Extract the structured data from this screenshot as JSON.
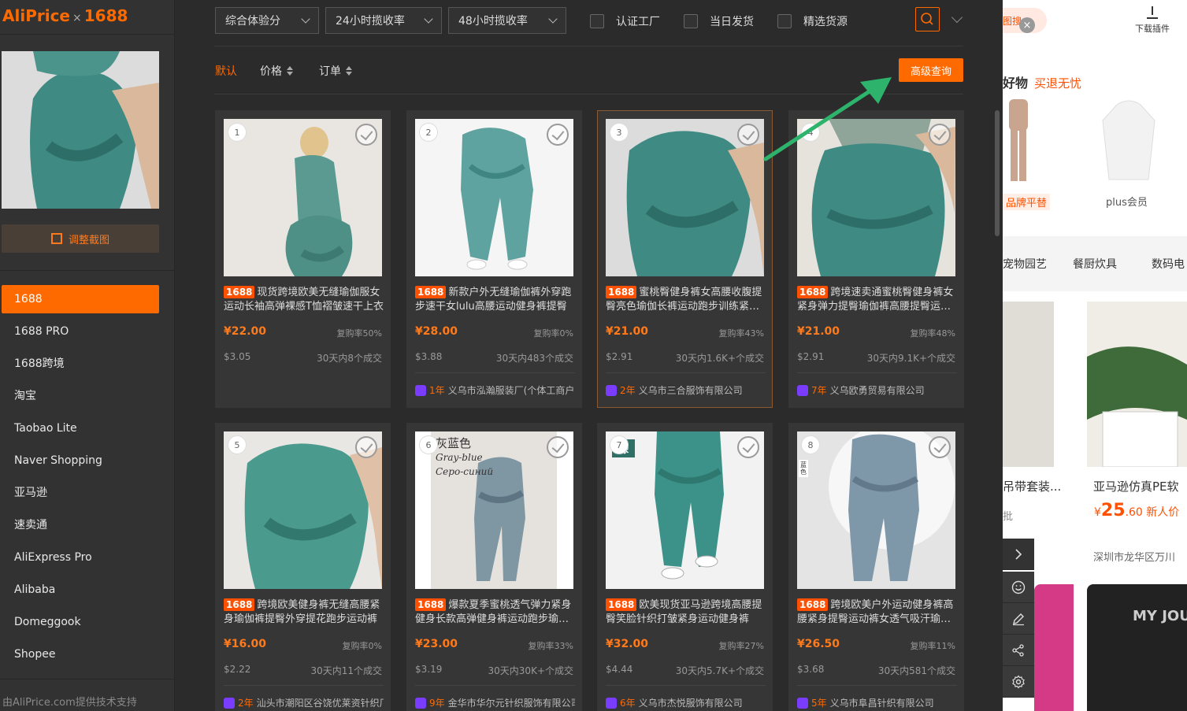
{
  "logo": {
    "brand": "AliPrice",
    "times": "×",
    "platform": "1688"
  },
  "crop_button": "调整截图",
  "platforms": [
    {
      "label": "1688",
      "active": true
    },
    {
      "label": "1688 PRO"
    },
    {
      "label": "1688跨境"
    },
    {
      "label": "淘宝"
    },
    {
      "label": "Taobao Lite"
    },
    {
      "label": "Naver Shopping"
    },
    {
      "label": "亚马逊"
    },
    {
      "label": "速卖通"
    },
    {
      "label": "AliExpress Pro"
    },
    {
      "label": "Alibaba"
    },
    {
      "label": "Domeggook"
    },
    {
      "label": "Shopee"
    }
  ],
  "powered_by": "由AliPrice.com提供技术支持",
  "filters": {
    "dropdowns": [
      "综合体验分",
      "24小时揽收率",
      "48小时揽收率"
    ],
    "checkboxes": [
      "认证工厂",
      "当日发货",
      "精选货源"
    ]
  },
  "sort": {
    "default": "默认",
    "price": "价格",
    "orders": "订单"
  },
  "advanced_query": "高级查询",
  "products": [
    {
      "num": "1",
      "tag": "1688",
      "title": "现货跨境欧美无缝瑜伽服女运动长袖高弹裸感T恤褶皱速干上衣",
      "price": "¥22.00",
      "repurchase": "复购率50%",
      "usd": "$3.05",
      "deals": "30天内8个成交",
      "shop_years": "",
      "shop": ""
    },
    {
      "num": "2",
      "tag": "1688",
      "title": "新款户外无缝瑜伽裤外穿跑步速干女lulu高腰运动健身裤提臀",
      "price": "¥28.00",
      "repurchase": "复购率0%",
      "usd": "$3.88",
      "deals": "30天内483个成交",
      "shop_years": "1年",
      "shop": "义乌市泓瀚服装厂(个体工商户)"
    },
    {
      "num": "3",
      "tag": "1688",
      "title": "蜜桃臀健身裤女高腰收腹提臀亮色瑜伽长裤运动跑步训练紧身裤",
      "price": "¥21.00",
      "repurchase": "复购率43%",
      "usd": "$2.91",
      "deals": "30天内1.6K+个成交",
      "shop_years": "2年",
      "shop": "义乌市三合服饰有限公司"
    },
    {
      "num": "4",
      "tag": "1688",
      "title": "跨境速卖通蜜桃臀健身裤女紧身弹力提臀瑜伽裤高腰提臀运动裤",
      "price": "¥21.00",
      "repurchase": "复购率48%",
      "usd": "$2.91",
      "deals": "30天内9.1K+个成交",
      "shop_years": "7年",
      "shop": "义乌欧勇贸易有限公司"
    },
    {
      "num": "5",
      "tag": "1688",
      "title": "跨境欧美健身裤无缝高腰紧身瑜伽裤提臀外穿提花跑步运动裤",
      "price": "¥16.00",
      "repurchase": "复购率0%",
      "usd": "$2.22",
      "deals": "30天内11个成交",
      "shop_years": "2年",
      "shop": "汕头市潮阳区谷饶优莱资针织厂"
    },
    {
      "num": "6",
      "tag": "1688",
      "title": "爆款夏季蜜桃透气弹力紧身健身长款高弹健身裤运动跑步瑜伽裤",
      "price": "¥23.00",
      "repurchase": "复购率33%",
      "usd": "$3.19",
      "deals": "30天内30K+个成交",
      "shop_years": "9年",
      "shop": "金华市华尔元针织服饰有限公司"
    },
    {
      "num": "7",
      "tag": "1688",
      "title": "欧美现货亚马逊跨境高腰提臀笑脸针织打皱紧身运动健身裤",
      "price": "¥32.00",
      "repurchase": "复购率27%",
      "usd": "$4.44",
      "deals": "30天内5.7K+个成交",
      "shop_years": "6年",
      "shop": "义乌市杰悦服饰有限公司"
    },
    {
      "num": "8",
      "tag": "1688",
      "title": "跨境欧美户外运动健身裤高腰紧身提臀运动裤女透气吸汗瑜伽裤",
      "price": "¥26.50",
      "repurchase": "复购率11%",
      "usd": "$3.68",
      "deals": "30天内581个成交",
      "shop_years": "5年",
      "shop": "义乌市阜昌针织有限公司"
    }
  ],
  "image_overlays": {
    "p6_text": "灰蓝色",
    "p6_en": "Gray-blue",
    "p6_ru": "Серо-синий",
    "p7_tag": "绿",
    "p8_text": "蓝色"
  },
  "background_page": {
    "tag": "图搜",
    "download": "下载插件",
    "hot_title": "好物",
    "hot_sub": "买退无忧",
    "label_brand": "品牌平替",
    "label_plus": "plus会员",
    "categories": [
      "宠物园艺",
      "餐厨炊具",
      "数码电"
    ],
    "product_title_left": "吊带套装...",
    "product_title_right": "亚马逊仿真PE软",
    "wholesale": "批",
    "price_symbol": "¥",
    "price_int": "25",
    "price_dec": ".60",
    "price_note": "新人价",
    "location": "深圳市龙华区万川",
    "jersey_text": "MY JOU"
  },
  "colors": {
    "accent": "#ff6a00",
    "panel": "#2b2b2b",
    "sidebar": "#323232",
    "card": "#363636"
  }
}
